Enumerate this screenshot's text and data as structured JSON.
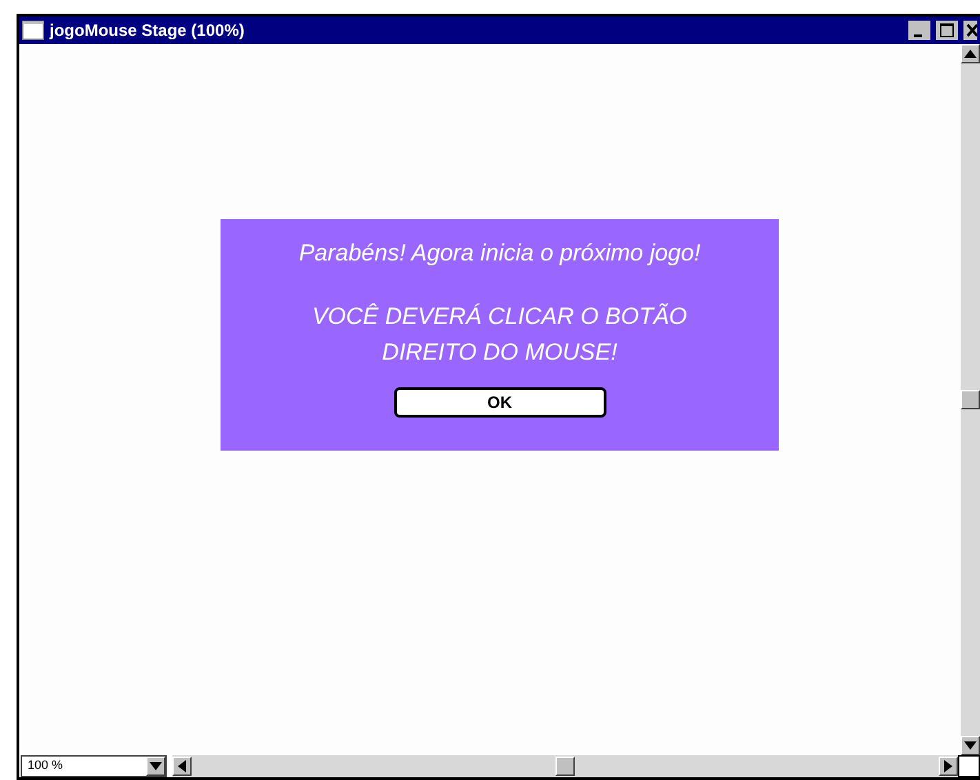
{
  "window": {
    "title": "jogoMouse Stage (100%)"
  },
  "dialog": {
    "message": "Parabéns! Agora inicia o próximo jogo!",
    "instruction": "VOCÊ DEVERÁ CLICAR O BOTÃO DIREITO DO MOUSE!",
    "button": "OK"
  },
  "zoom": {
    "value": "100 %"
  }
}
